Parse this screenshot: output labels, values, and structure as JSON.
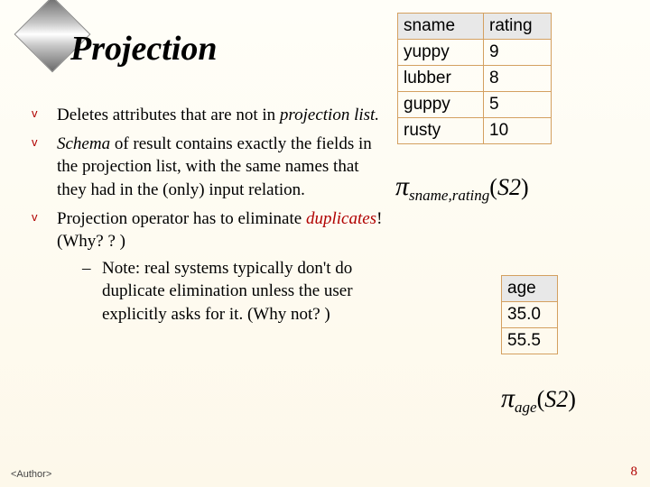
{
  "title": "Projection",
  "bullets": {
    "b1a": "Deletes attributes that are not in ",
    "b1b": "projection list.",
    "b2a": "Schema",
    "b2b": " of result contains exactly the fields in the projection list, with the same names that they had in the (only) input relation.",
    "b3a": "Projection operator has to eliminate ",
    "b3b": "duplicates",
    "b3c": "!  (Why? ? )",
    "sub1": "Note: real systems typically don't do duplicate elimination unless the user explicitly asks for it. (Why not? )"
  },
  "table1": {
    "headers": [
      "sname",
      "rating"
    ],
    "rows": [
      [
        "yuppy",
        "9"
      ],
      [
        "lubber",
        "8"
      ],
      [
        "guppy",
        "5"
      ],
      [
        "rusty",
        "10"
      ]
    ]
  },
  "formula1": {
    "sub": "sname,rating",
    "arg": "S2"
  },
  "table2": {
    "header": "age",
    "rows": [
      "35.0",
      "55.5"
    ]
  },
  "formula2": {
    "sub": "age",
    "arg": "S2"
  },
  "footer": {
    "author": "<Author>",
    "page": "8"
  }
}
